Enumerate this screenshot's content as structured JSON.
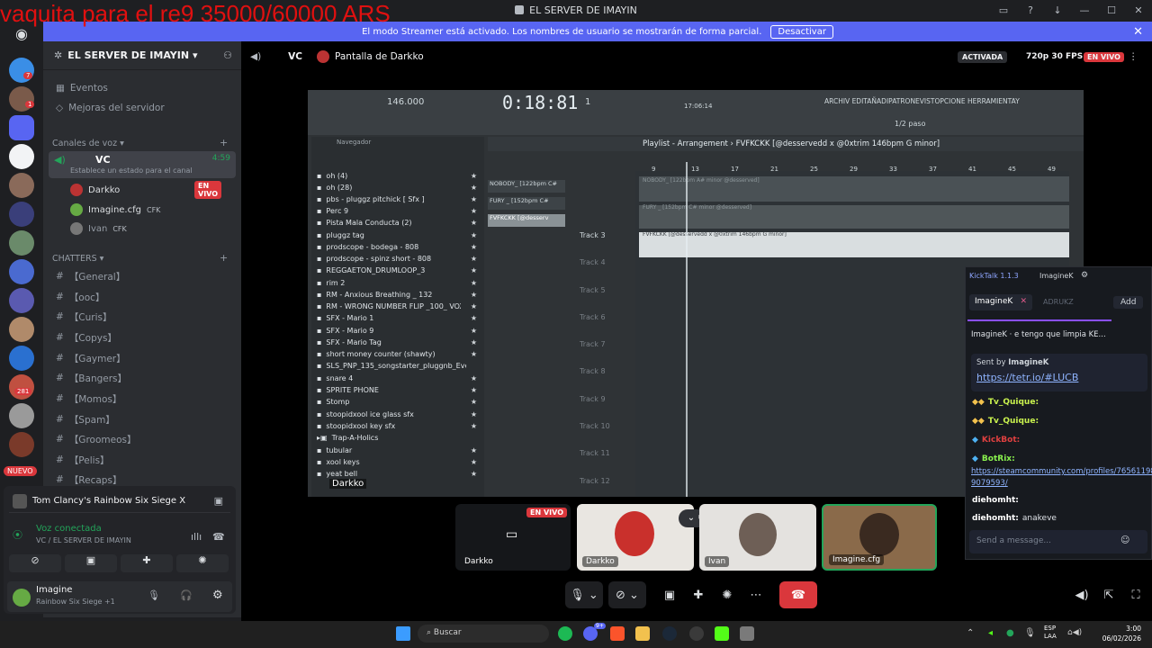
{
  "overlay_text": "vaquita para el re9 35000/60000 ARS",
  "window": {
    "title": "EL SERVER DE IMAYIN"
  },
  "banner": {
    "text": "El modo Streamer está activado. Los nombres de usuario se mostrarán de forma parcial.",
    "button": "Desactivar"
  },
  "server": {
    "name": "EL SERVER DE IMAYIN"
  },
  "sidebar": {
    "top_items": [
      "Eventos",
      "Mejoras del servidor"
    ],
    "voice_category": "Canales de voz",
    "voice_channel": {
      "name": "VC",
      "timer": "4:59",
      "status": "Establece un estado para el canal"
    },
    "voice_users": [
      {
        "name": "Darkko",
        "badge": "EN VIVO"
      },
      {
        "name": "Imagine.cfg",
        "tag": "CFK"
      },
      {
        "name": "Ivan",
        "tag": "CFK"
      }
    ],
    "text_category": "CHATTERS",
    "text_channels": [
      "【General】",
      "【ooc】",
      "【Curis】",
      "【Copys】",
      "【Gaymer】",
      "【Bangers】",
      "【Momos】",
      "【Spam】",
      "【Groomeos】",
      "【Pelis】",
      "【Recaps】"
    ]
  },
  "servers_rail": {
    "badges": [
      "7",
      "1",
      "281"
    ],
    "new_label": "NUEVO"
  },
  "activity": {
    "game": "Tom Clancy's Rainbow Six Siege X"
  },
  "connection": {
    "status": "Voz conectada",
    "channel": "VC / EL SERVER DE IMAYIN"
  },
  "user": {
    "name": "Imagine",
    "status": "Rainbow Six Siege +1"
  },
  "stage_top": {
    "channel": "VC",
    "stream_title": "Pantalla de Darkko",
    "activated": "ACTIVADA",
    "quality": "720p 30 FPS",
    "live": "EN VIVO"
  },
  "fl": {
    "tempo": "146.000",
    "time": "0:18:81",
    "pattern": "1",
    "cpu": "17:06:14",
    "menu": "ARCHIV EDITAÑADIPATRONEVISTOPCIONE HERRAMIENTAY",
    "browser_title": "Navegador",
    "playlist_title": "Playlist - Arrangement",
    "playlist_song": "FVFKCKK [@desservedd x @0xtrim 146bpm G minor]",
    "step_label": "1/2 paso",
    "browser_items": [
      "oh  (4)",
      "oh  (28)",
      "pbs - pluggz pitchick [ Sfx ]",
      "Perc 9",
      "Pista Mala Conducta (2)",
      "pluggz tag",
      "prodscope - bodega - 808",
      "prodscope - spinz short - 808",
      "REGGAETON_DRUMLOOP_3",
      "rim 2",
      "RM - Anxious Breathing _ 132",
      "RM - WRONG NUMBER FLIP _100_ VOX LOOPS",
      "SFX - Mario 1",
      "SFX - Mario 9",
      "SFX - Mario Tag",
      "short money counter (shawty)",
      "SLS_PNP_135_songstarter_pluggnb_Ever_Cmaj",
      "snare 4",
      "SPRITE PHONE",
      "Stomp",
      "stoopidxool ice glass sfx",
      "stoopidxool key sfx",
      "Trap-A-Holics",
      "tubular",
      "xool keys",
      "yeat bell"
    ],
    "clips": [
      "NOBODY_ [122bpm C#",
      "FURY _ [152bpm C#",
      "FVFKCKK [@desserv"
    ],
    "tracks": [
      "Track 3",
      "Track 4",
      "Track 5",
      "Track 6",
      "Track 7",
      "Track 8",
      "Track 9",
      "Track 10",
      "Track 11",
      "Track 12"
    ],
    "audio_labels": [
      "NOBODY_ [122bpm A# minor @desserved]",
      "FURY _ [152bpm C# minor @desserved]",
      "FVFKCKK [@desservedd x @0xtrim 146bpm G minor]"
    ],
    "ruler": [
      "9",
      "13",
      "17",
      "21",
      "25",
      "29",
      "33",
      "37",
      "41",
      "45",
      "49"
    ],
    "stream_owner": "Darkko"
  },
  "kick": {
    "title": "KickTalk 1.1.3",
    "tab_title": "ImagineK",
    "tabs": [
      "ImagineK",
      "ADRUKZ",
      "Add"
    ],
    "pinned": "ImagineK · e tengo que limpia KE...",
    "sent_by": "Sent by",
    "sent_user": "ImagineK",
    "link": "https://tetr.io/#LUCB",
    "messages": [
      {
        "user": "Tv_Quique:",
        "text": ""
      },
      {
        "user": "Tv_Quique:",
        "text": ""
      },
      {
        "user": "KickBot:",
        "text": ""
      },
      {
        "user": "BotRix:",
        "text": "https://steamcommunity.com/profiles/7656119880 9079593/"
      },
      {
        "user": "diehomht:",
        "text": ""
      },
      {
        "user": "diehomht:",
        "text": "anakeve"
      }
    ],
    "input_placeholder": "Send a message..."
  },
  "tiles": [
    {
      "name": "Darkko",
      "badge": "EN VIVO"
    },
    {
      "name": "Darkko"
    },
    {
      "name": "Ivan"
    },
    {
      "name": "Imagine.cfg"
    }
  ],
  "taskbar": {
    "search": "Buscar",
    "lang": "ESP",
    "region": "LAA",
    "time": "3:00",
    "date": "06/02/2026",
    "notif": "9+"
  },
  "colors": {
    "accent": "#5865f2",
    "live": "#da373c",
    "connected": "#23a55a",
    "overlay": "#e01010"
  }
}
